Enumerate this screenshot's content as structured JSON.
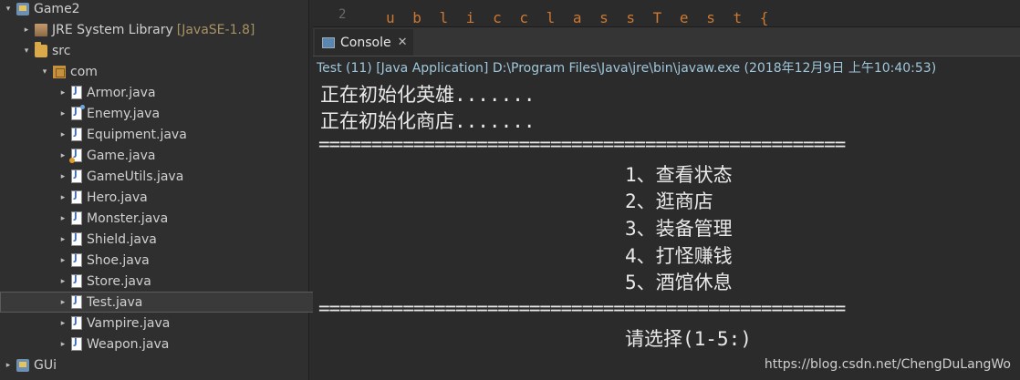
{
  "explorer": {
    "items": [
      {
        "label": "Game2",
        "icon": "project-icon",
        "arrow": "▾",
        "indent": 0
      },
      {
        "label": "JRE System Library",
        "suffix": "[JavaSE-1.8]",
        "icon": "library-icon",
        "arrow": "▸",
        "indent": 1
      },
      {
        "label": "src",
        "icon": "source-folder-icon",
        "arrow": "▾",
        "indent": 1
      },
      {
        "label": "com",
        "icon": "package-icon",
        "arrow": "▾",
        "indent": 2
      },
      {
        "label": "Armor.java",
        "icon": "java-file-icon",
        "arrow": "▸",
        "indent": 3
      },
      {
        "label": "Enemy.java",
        "icon": "java-file-icon",
        "arrow": "▸",
        "indent": 3
      },
      {
        "label": "Equipment.java",
        "icon": "java-file-icon",
        "arrow": "▸",
        "indent": 3
      },
      {
        "label": "Game.java",
        "icon": "java-file-icon",
        "arrow": "▸",
        "indent": 3
      },
      {
        "label": "GameUtils.java",
        "icon": "java-file-icon",
        "arrow": "▸",
        "indent": 3
      },
      {
        "label": "Hero.java",
        "icon": "java-file-icon",
        "arrow": "▸",
        "indent": 3
      },
      {
        "label": "Monster.java",
        "icon": "java-file-icon",
        "arrow": "▸",
        "indent": 3
      },
      {
        "label": "Shield.java",
        "icon": "java-file-icon",
        "arrow": "▸",
        "indent": 3
      },
      {
        "label": "Shoe.java",
        "icon": "java-file-icon",
        "arrow": "▸",
        "indent": 3
      },
      {
        "label": "Store.java",
        "icon": "java-file-icon",
        "arrow": "▸",
        "indent": 3
      },
      {
        "label": "Test.java",
        "icon": "java-file-icon",
        "arrow": "▸",
        "indent": 3,
        "selected": true
      },
      {
        "label": "Vampire.java",
        "icon": "java-file-icon",
        "arrow": "▸",
        "indent": 3
      },
      {
        "label": "Weapon.java",
        "icon": "java-file-icon",
        "arrow": "▸",
        "indent": 3
      },
      {
        "label": "GUi",
        "icon": "project-icon",
        "arrow": "▸",
        "indent": 0
      }
    ]
  },
  "editor": {
    "line_number": "2"
  },
  "console": {
    "tab_label": "Console",
    "launch_info": "Test (11) [Java Application] D:\\Program Files\\Java\\jre\\bin\\javaw.exe (2018年12月9日 上午10:40:53)",
    "lines": {
      "init_hero": "正在初始化英雄.......",
      "init_store": "正在初始化商店.......",
      "separator": "==================================================",
      "menu_1": "1、查看状态",
      "menu_2": "2、逛商店",
      "menu_3": "3、装备管理",
      "menu_4": "4、打怪赚钱",
      "menu_5": "5、酒馆休息",
      "prompt": "请选择(1-5:)"
    }
  },
  "watermark": "https://blog.csdn.net/ChengDuLangWo",
  "colors": {
    "background": "#2b2b2b",
    "launch_info": "#9fc7dc",
    "suffix": "#a89264",
    "console_text": "#e9e9e9"
  }
}
